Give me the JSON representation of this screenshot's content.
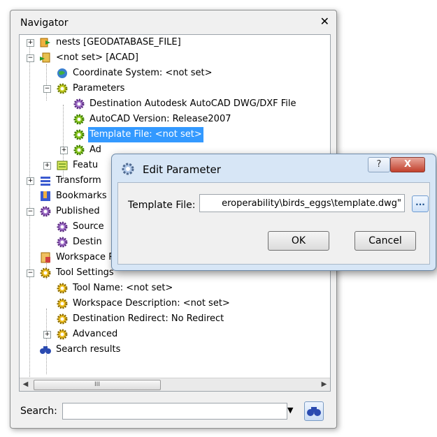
{
  "navigator": {
    "title": "Navigator",
    "close": "✕",
    "tree": [
      {
        "label": "nests [GEODATABASE_FILE]",
        "icon": "reader-icon"
      },
      {
        "label": "<not set> [ACAD]",
        "icon": "writer-icon"
      },
      {
        "label": "Coordinate System: <not set>",
        "icon": "globe-icon"
      },
      {
        "label": "Parameters",
        "icon": "gear-icon"
      },
      {
        "label": "Destination Autodesk AutoCAD DWG/DXF File",
        "icon": "gear-purple-icon"
      },
      {
        "label": "AutoCAD Version: Release2007",
        "icon": "gear-icon"
      },
      {
        "label": "Template File: <not set>",
        "icon": "gear-icon"
      },
      {
        "label": "Ad",
        "icon": "gear-icon"
      },
      {
        "label": "Featu",
        "icon": "feature-icon"
      },
      {
        "label": "Transform",
        "icon": "transformer-icon"
      },
      {
        "label": "Bookmarks",
        "icon": "bookmark-icon"
      },
      {
        "label": "Published",
        "icon": "gear-purple-icon"
      },
      {
        "label": "Source",
        "icon": "gear-purple-icon"
      },
      {
        "label": "Destin",
        "icon": "gear-purple-icon"
      },
      {
        "label": "Workspace Resources",
        "icon": "resources-icon"
      },
      {
        "label": "Tool Settings",
        "icon": "gear-icon"
      },
      {
        "label": "Tool Name: <not set>",
        "icon": "gear-icon"
      },
      {
        "label": "Workspace Description: <not set>",
        "icon": "gear-icon"
      },
      {
        "label": "Destination Redirect: No Redirect",
        "icon": "gear-icon"
      },
      {
        "label": "Advanced",
        "icon": "gear-icon"
      },
      {
        "label": "Search results",
        "icon": "binoculars-icon"
      }
    ],
    "scroll_thumb": "III",
    "search_label": "Search:",
    "search_value": ""
  },
  "dialog": {
    "title": "Edit Parameter",
    "help": "?",
    "close": "X",
    "field_label": "Template File:",
    "field_value": "eroperability\\birds_eggs\\template.dwg\"",
    "browse": "...",
    "ok": "OK",
    "cancel": "Cancel"
  }
}
